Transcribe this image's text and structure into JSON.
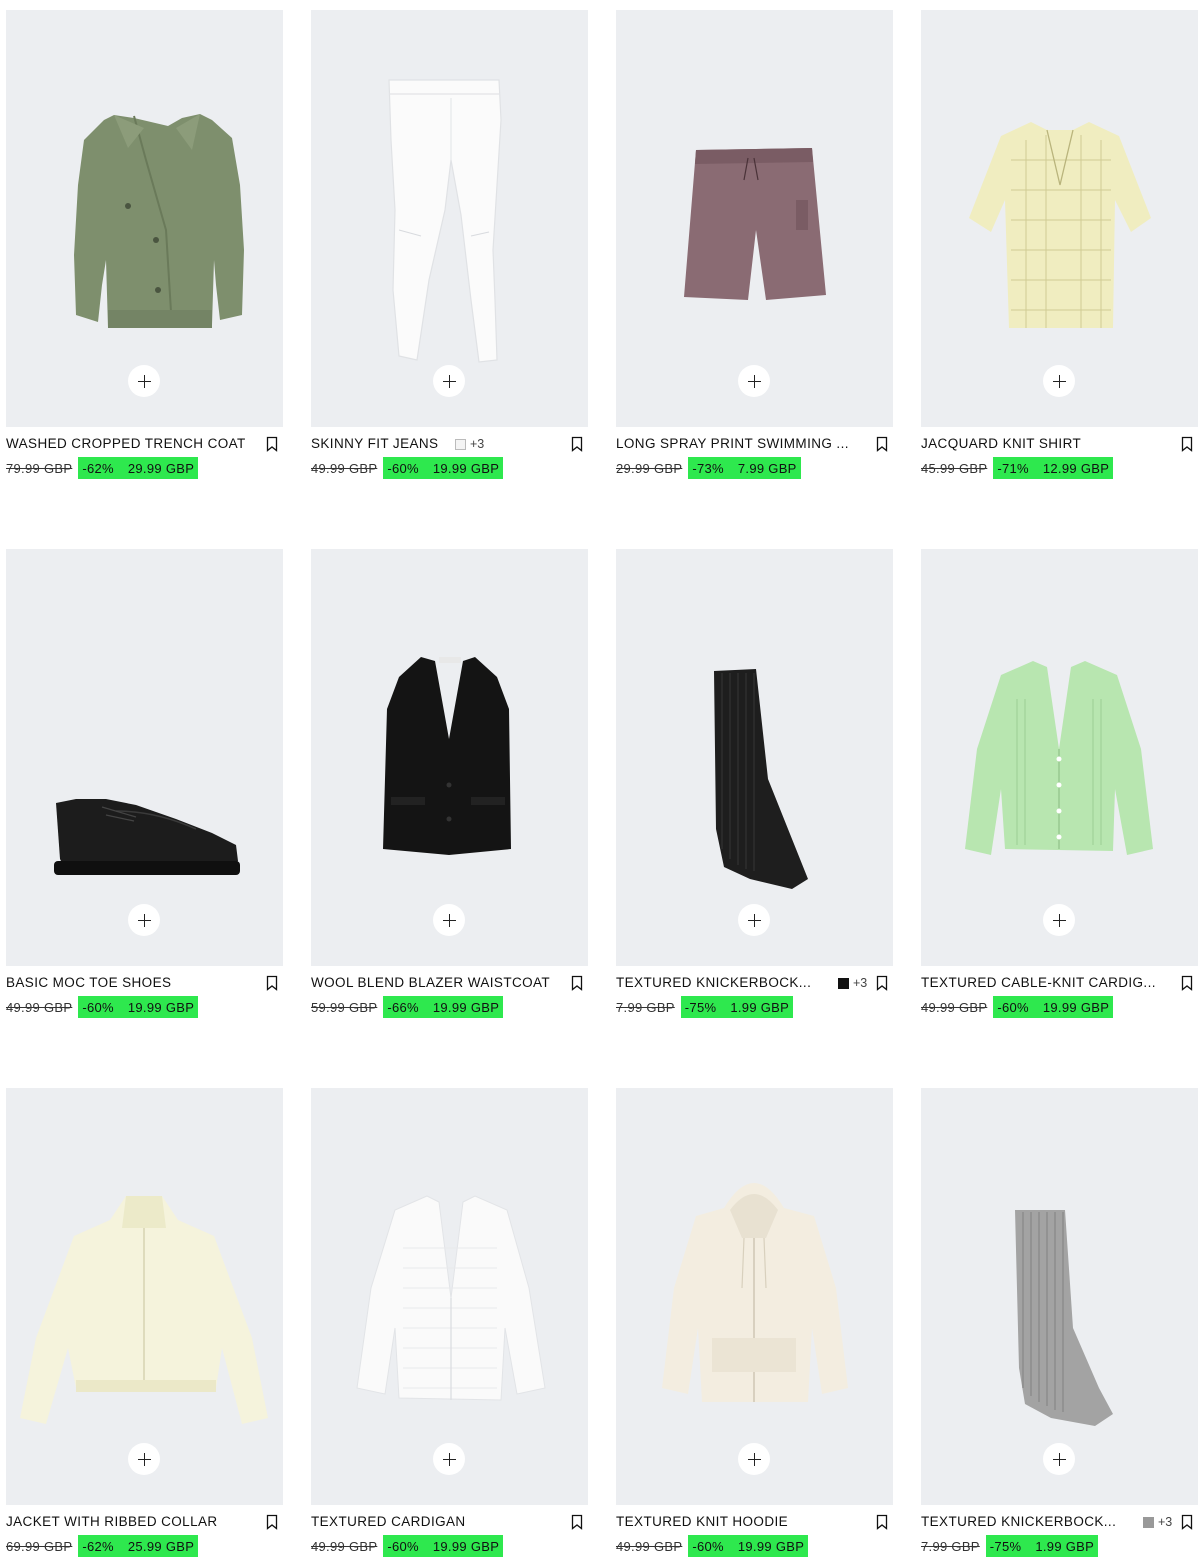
{
  "colors": {
    "card_bg": "#eceef1",
    "sale_bg": "#2ee84e"
  },
  "products": [
    {
      "name": "WASHED CROPPED TRENCH COAT",
      "old_price": "79.99 GBP",
      "discount": "-62%",
      "price": "29.99 GBP",
      "swatch": null,
      "more_colors": null,
      "image": "green-jacket-icon"
    },
    {
      "name": "SKINNY FIT JEANS",
      "old_price": "49.99 GBP",
      "discount": "-60%",
      "price": "19.99 GBP",
      "swatch": "#f4f4f4",
      "more_colors": "+3",
      "image": "white-jeans-icon"
    },
    {
      "name": "LONG SPRAY PRINT SWIMMING ...",
      "old_price": "29.99 GBP",
      "discount": "-73%",
      "price": "7.99 GBP",
      "swatch": null,
      "more_colors": null,
      "image": "swim-shorts-icon"
    },
    {
      "name": "JACQUARD KNIT SHIRT",
      "old_price": "45.99 GBP",
      "discount": "-71%",
      "price": "12.99 GBP",
      "swatch": null,
      "more_colors": null,
      "image": "knit-shirt-icon"
    },
    {
      "name": "BASIC MOC TOE SHOES",
      "old_price": "49.99 GBP",
      "discount": "-60%",
      "price": "19.99 GBP",
      "swatch": null,
      "more_colors": null,
      "image": "black-shoe-icon"
    },
    {
      "name": "WOOL BLEND BLAZER WAISTCOAT",
      "old_price": "59.99 GBP",
      "discount": "-66%",
      "price": "19.99 GBP",
      "swatch": null,
      "more_colors": null,
      "image": "waistcoat-icon"
    },
    {
      "name": "TEXTURED KNICKERBOCK...",
      "old_price": "7.99 GBP",
      "discount": "-75%",
      "price": "1.99 GBP",
      "swatch": "#111111",
      "more_colors": "+3",
      "image": "black-sock-icon"
    },
    {
      "name": "TEXTURED CABLE-KNIT CARDIG...",
      "old_price": "49.99 GBP",
      "discount": "-60%",
      "price": "19.99 GBP",
      "swatch": null,
      "more_colors": null,
      "image": "green-cardigan-icon"
    },
    {
      "name": "JACKET WITH RIBBED COLLAR",
      "old_price": "69.99 GBP",
      "discount": "-62%",
      "price": "25.99 GBP",
      "swatch": null,
      "more_colors": null,
      "image": "cream-jacket-icon"
    },
    {
      "name": "TEXTURED CARDIGAN",
      "old_price": "49.99 GBP",
      "discount": "-60%",
      "price": "19.99 GBP",
      "swatch": null,
      "more_colors": null,
      "image": "white-cardigan-icon"
    },
    {
      "name": "TEXTURED KNIT HOODIE",
      "old_price": "49.99 GBP",
      "discount": "-60%",
      "price": "19.99 GBP",
      "swatch": null,
      "more_colors": null,
      "image": "knit-hoodie-icon"
    },
    {
      "name": "TEXTURED KNICKERBOCK...",
      "old_price": "7.99 GBP",
      "discount": "-75%",
      "price": "1.99 GBP",
      "swatch": "#999999",
      "more_colors": "+3",
      "image": "grey-sock-icon"
    }
  ]
}
